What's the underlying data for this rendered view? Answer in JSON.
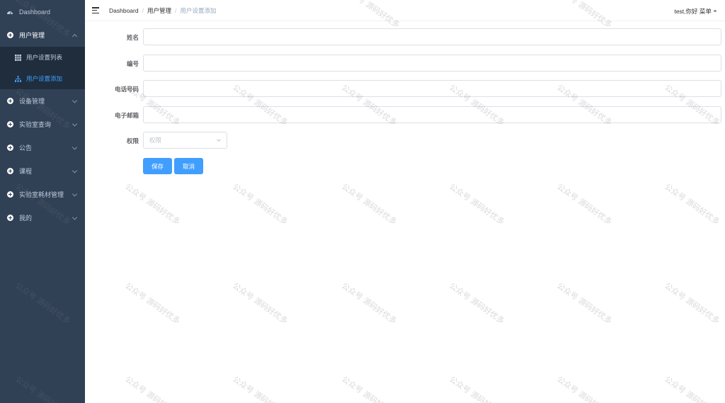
{
  "sidebar": {
    "items": [
      {
        "label": "Dashboard",
        "icon": "dashboard-icon"
      },
      {
        "label": "用户管理",
        "icon": "plus-circle-icon",
        "open": true,
        "children": [
          {
            "label": "用户设置列表",
            "icon": "table-icon"
          },
          {
            "label": "用户设置添加",
            "icon": "tree-icon",
            "active": true
          }
        ]
      },
      {
        "label": "设备管理",
        "icon": "plus-circle-icon"
      },
      {
        "label": "实验室查询",
        "icon": "plus-circle-icon"
      },
      {
        "label": "公告",
        "icon": "plus-circle-icon"
      },
      {
        "label": "课程",
        "icon": "plus-circle-icon"
      },
      {
        "label": "实验室耗材管理",
        "icon": "plus-circle-icon"
      },
      {
        "label": "我的",
        "icon": "plus-circle-icon"
      }
    ]
  },
  "header": {
    "breadcrumb": [
      "Dashboard",
      "用户管理",
      "用户设置添加"
    ],
    "separator": "/",
    "user_text": "test,你好 菜单",
    "user_caret": "≡"
  },
  "form": {
    "fields": [
      {
        "label": "姓名",
        "value": ""
      },
      {
        "label": "编号",
        "value": ""
      },
      {
        "label": "电话号码",
        "value": ""
      },
      {
        "label": "电子邮箱",
        "value": ""
      }
    ],
    "permission": {
      "label": "权限",
      "placeholder": "权限"
    },
    "save_label": "保存",
    "cancel_label": "取消"
  },
  "watermark": {
    "text": "公众号 源码好优多"
  },
  "colors": {
    "sidebar_bg": "#304156",
    "submenu_bg": "#1f2d3d",
    "accent": "#409eff"
  }
}
